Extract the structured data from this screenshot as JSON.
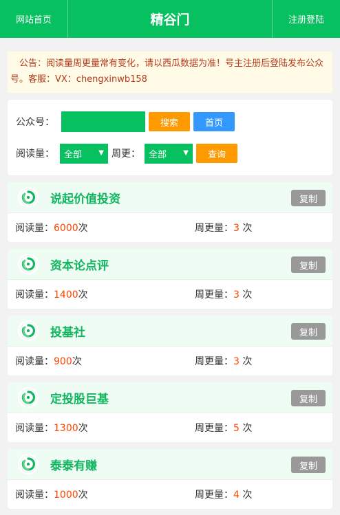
{
  "header": {
    "home_label": "网站首页",
    "title": "精谷门",
    "register_label": "注册登陆"
  },
  "notice": {
    "text": "公告：阅读量周更量常有变化，请以西瓜数据为准！号主注册后登陆发布公众号。客服：VX：chengxinwb158"
  },
  "search": {
    "account_label": "公众号：",
    "account_value": "",
    "search_button": "搜索",
    "home_button": "首页",
    "read_label": "阅读量：",
    "read_selected": "全部",
    "weekly_label": "周更：",
    "weekly_selected": "全部",
    "query_button": "查询"
  },
  "list": {
    "read_label": "阅读量：",
    "read_unit": "次",
    "weekly_label": "周更量：",
    "weekly_unit": " 次",
    "copy_label": "复制",
    "items": [
      {
        "name": "说起价值投资",
        "reads": "6000",
        "weekly": "3"
      },
      {
        "name": "资本论点评",
        "reads": "1400",
        "weekly": "3"
      },
      {
        "name": "投基社",
        "reads": "900",
        "weekly": "3"
      },
      {
        "name": "定投股巨基",
        "reads": "1300",
        "weekly": "5"
      },
      {
        "name": "泰泰有赚",
        "reads": "1000",
        "weekly": "4"
      }
    ]
  },
  "colors": {
    "brand_green": "#07c160",
    "orange": "#ff9900",
    "blue": "#3399ff",
    "highlight_red": "#ff4400"
  }
}
